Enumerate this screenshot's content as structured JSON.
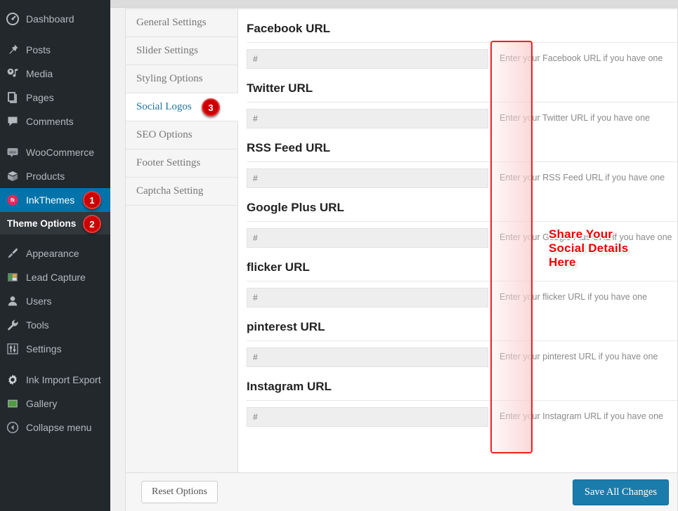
{
  "sidebar": {
    "items": [
      {
        "label": "Dashboard",
        "icon": "dashboard-icon",
        "state": "normal"
      },
      {
        "label": "Posts",
        "icon": "pin-icon",
        "state": "normal"
      },
      {
        "label": "Media",
        "icon": "media-icon",
        "state": "normal"
      },
      {
        "label": "Pages",
        "icon": "pages-icon",
        "state": "normal"
      },
      {
        "label": "Comments",
        "icon": "comments-icon",
        "state": "normal"
      },
      {
        "label": "WooCommerce",
        "icon": "woocommerce-icon",
        "state": "normal"
      },
      {
        "label": "Products",
        "icon": "products-box-icon",
        "state": "normal"
      },
      {
        "label": "InkThemes",
        "icon": "inkthemes-icon",
        "state": "current"
      },
      {
        "label": "Theme Options",
        "icon": "none",
        "state": "submenu"
      },
      {
        "label": "Appearance",
        "icon": "brush-icon",
        "state": "normal"
      },
      {
        "label": "Lead Capture",
        "icon": "lead-capture-icon",
        "state": "normal"
      },
      {
        "label": "Users",
        "icon": "user-icon",
        "state": "normal"
      },
      {
        "label": "Tools",
        "icon": "wrench-icon",
        "state": "normal"
      },
      {
        "label": "Settings",
        "icon": "sliders-icon",
        "state": "normal"
      },
      {
        "label": "Ink Import Export",
        "icon": "gear-icon",
        "state": "normal"
      },
      {
        "label": "Gallery",
        "icon": "gallery-icon",
        "state": "normal"
      },
      {
        "label": "Collapse menu",
        "icon": "collapse-arrow-icon",
        "state": "normal"
      }
    ]
  },
  "badges": [
    {
      "number": "1",
      "for": "InkThemes"
    },
    {
      "number": "2",
      "for": "Theme Options"
    },
    {
      "number": "3",
      "for": "Social Logos"
    }
  ],
  "tabs": [
    {
      "label": "General Settings",
      "active": false
    },
    {
      "label": "Slider Settings",
      "active": false
    },
    {
      "label": "Styling Options",
      "active": false
    },
    {
      "label": "Social Logos",
      "active": true
    },
    {
      "label": "SEO Options",
      "active": false
    },
    {
      "label": "Footer Settings",
      "active": false
    },
    {
      "label": "Captcha Setting",
      "active": false
    }
  ],
  "fields": [
    {
      "heading": "Facebook URL",
      "value": "#",
      "description": "Enter your Facebook URL if you have one"
    },
    {
      "heading": "Twitter URL",
      "value": "#",
      "description": "Enter your Twitter URL if you have one"
    },
    {
      "heading": "RSS Feed URL",
      "value": "#",
      "description": "Enter your RSS Feed URL if you have one"
    },
    {
      "heading": "Google Plus URL",
      "value": "#",
      "description": "Enter your Google Plus URL if you have one"
    },
    {
      "heading": "flicker URL",
      "value": "#",
      "description": "Enter your flicker URL if you have one"
    },
    {
      "heading": "pinterest URL",
      "value": "#",
      "description": "Enter your pinterest URL if you have one"
    },
    {
      "heading": "Instagram URL",
      "value": "#",
      "description": "Enter your Instagram URL if you have one"
    }
  ],
  "actions": {
    "reset_label": "Reset Options",
    "save_label": "Save All Changes"
  },
  "annotation": {
    "line1": "Share Your",
    "line2": "Social Details",
    "line3": "Here",
    "color": "#ee0000",
    "highlight_color": "#f02020"
  }
}
